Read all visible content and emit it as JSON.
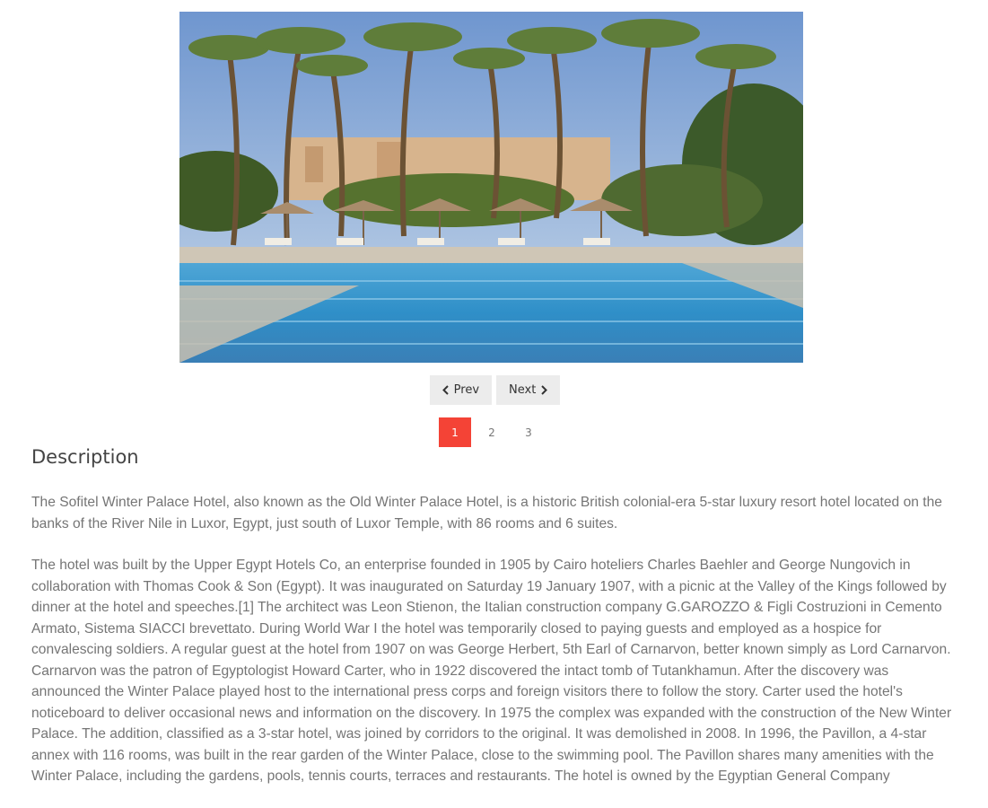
{
  "gallery": {
    "image_alt": "Swimming pool surrounded by palm trees and umbrellas",
    "prev_label": "Prev",
    "next_label": "Next",
    "pages": [
      "1",
      "2",
      "3"
    ],
    "active_page": "1"
  },
  "description": {
    "heading": "Description",
    "paragraph_1": "The Sofitel Winter Palace Hotel, also known as the Old Winter Palace Hotel, is a historic British colonial-era 5-star luxury resort hotel located on the banks of the River Nile in Luxor, Egypt, just south of Luxor Temple, with 86 rooms and 6 suites.",
    "paragraph_2": "The hotel was built by the Upper Egypt Hotels Co, an enterprise founded in 1905 by Cairo hoteliers Charles Baehler and George Nungovich in collaboration with Thomas Cook & Son (Egypt). It was inaugurated on Saturday 19 January 1907, with a picnic at the Valley of the Kings followed by dinner at the hotel and speeches.[1] The architect was Leon Stienon, the Italian construction company G.GAROZZO & Figli Costruzioni in Cemento Armato, Sistema SIACCI brevettato. During World War I the hotel was temporarily closed to paying guests and employed as a hospice for convalescing soldiers. A regular guest at the hotel from 1907 on was George Herbert, 5th Earl of Carnarvon, better known simply as Lord Carnarvon. Carnarvon was the patron of Egyptologist Howard Carter, who in 1922 discovered the intact tomb of Tutankhamun. After the discovery was announced the Winter Palace played host to the international press corps and foreign visitors there to follow the story. Carter used the hotel's noticeboard to deliver occasional news and information on the discovery. In 1975 the complex was expanded with the construction of the New Winter Palace. The addition, classified as a 3-star hotel, was joined by corridors to the original. It was demolished in 2008. In 1996, the Pavillon, a 4-star annex with 116 rooms, was built in the rear garden of the Winter Palace, close to the swimming pool. The Pavillon shares many amenities with the Winter Palace, including the gardens, pools, tennis courts, terraces and restaurants. The hotel is owned by the Egyptian General Company"
  },
  "colors": {
    "active_page": "#f44336",
    "button_bg": "#ececec",
    "body_text": "#757575"
  },
  "icons": [
    "chevron-left-icon",
    "chevron-right-icon"
  ]
}
